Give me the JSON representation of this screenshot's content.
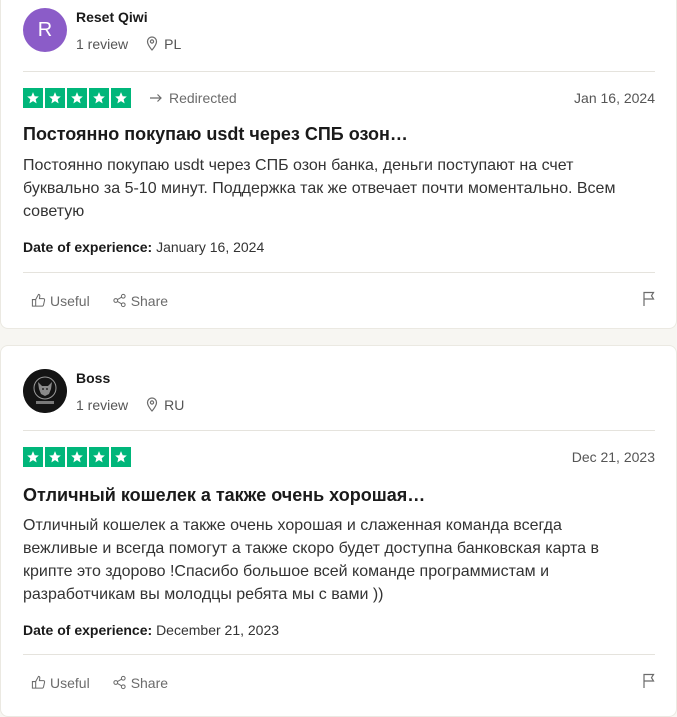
{
  "reviews": [
    {
      "avatar_letter": "R",
      "name": "Reset Qiwi",
      "review_count": "1 review",
      "country": "PL",
      "rating": 5,
      "redirected_label": "Redirected",
      "date": "Jan 16, 2024",
      "title": "Постоянно покупаю usdt через СПБ озон…",
      "body_lines": [
        "Постоянно покупаю usdt через СПБ озон банка, деньги поступают на счет",
        "буквально за 5-10 минут. Поддержка так же отвечает почти моментально. Всем",
        "советую"
      ],
      "doe_label": "Date of experience:",
      "doe_value": "January 16, 2024",
      "useful_label": "Useful",
      "share_label": "Share"
    },
    {
      "avatar_letter": "",
      "name": "Boss",
      "review_count": "1 review",
      "country": "RU",
      "rating": 5,
      "redirected_label": "",
      "date": "Dec 21, 2023",
      "title": "Отличный кошелек а также очень хорошая…",
      "body_lines": [
        "Отличный кошелек а также очень хорошая и слаженная команда всегда",
        "вежливые и всегда помогут а также скоро будет доступна банковская карта в",
        "крипте это здорово !Спасибо большое всей команде программистам и",
        "разработчикам вы молодцы ребята мы с вами ))"
      ],
      "doe_label": "Date of experience:",
      "doe_value": "December 21, 2023",
      "useful_label": "Useful",
      "share_label": "Share"
    }
  ],
  "colors": {
    "star_green": "#00b67a",
    "avatar_purple": "#8b5cc8"
  }
}
